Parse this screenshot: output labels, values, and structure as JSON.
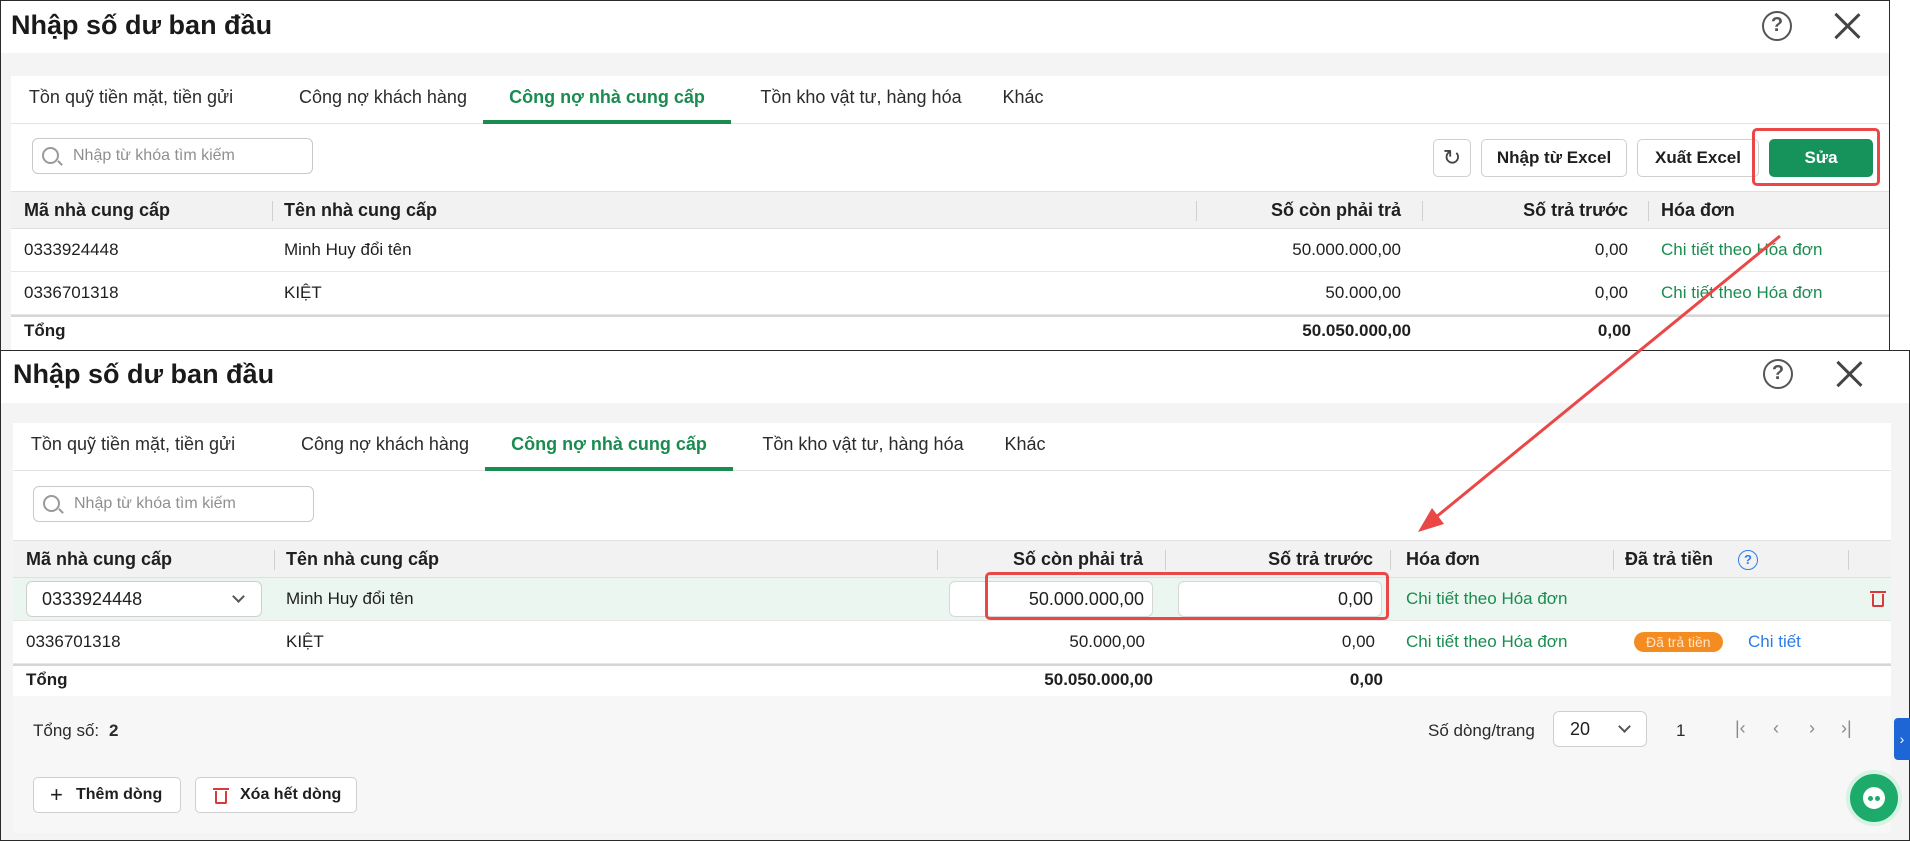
{
  "top_panel": {
    "title": "Nhập số dư ban đầu",
    "tabs": [
      "Tồn quỹ tiền mặt, tiền gửi",
      "Công nợ khách hàng",
      "Công nợ nhà cung cấp",
      "Tồn kho vật tư, hàng hóa",
      "Khác"
    ],
    "active_tab": "Công nợ nhà cung cấp",
    "search_placeholder": "Nhập từ khóa tìm kiếm",
    "buttons": {
      "import_excel": "Nhập từ Excel",
      "export_excel": "Xuất Excel",
      "edit": "Sửa"
    },
    "columns": [
      "Mã nhà cung cấp",
      "Tên nhà cung cấp",
      "Số còn phải trả",
      "Số trả trước",
      "Hóa đơn"
    ],
    "rows": [
      {
        "code": "0333924448",
        "name": "Minh Huy đổi tên",
        "payable": "50.000.000,00",
        "prepaid": "0,00",
        "invoice": "Chi tiết theo Hóa đơn"
      },
      {
        "code": "0336701318",
        "name": "KIỆT",
        "payable": "50.000,00",
        "prepaid": "0,00",
        "invoice": "Chi tiết theo Hóa đơn"
      }
    ],
    "total": {
      "label": "Tổng",
      "payable": "50.050.000,00",
      "prepaid": "0,00"
    }
  },
  "bottom_panel": {
    "title": "Nhập số dư ban đầu",
    "tabs": [
      "Tồn quỹ tiền mặt, tiền gửi",
      "Công nợ khách hàng",
      "Công nợ nhà cung cấp",
      "Tồn kho vật tư, hàng hóa",
      "Khác"
    ],
    "active_tab": "Công nợ nhà cung cấp",
    "search_placeholder": "Nhập từ khóa tìm kiếm",
    "columns": [
      "Mã nhà cung cấp",
      "Tên nhà cung cấp",
      "Số còn phải trả",
      "Số trả trước",
      "Hóa đơn",
      "Đã trả tiền"
    ],
    "rows": [
      {
        "code": "0333924448",
        "name": "Minh Huy đổi tên",
        "payable": "50.000.000,00",
        "prepaid": "0,00",
        "invoice": "Chi tiết theo Hóa đơn"
      },
      {
        "code": "0336701318",
        "name": "KIỆT",
        "payable": "50.000,00",
        "prepaid": "0,00",
        "invoice": "Chi tiết theo Hóa đơn",
        "paid_badge": "Đã trả tiền",
        "detail_link": "Chi tiết"
      }
    ],
    "total": {
      "label": "Tổng",
      "payable": "50.050.000,00",
      "prepaid": "0,00"
    },
    "record_count_label": "Tổng số:",
    "record_count": "2",
    "rows_per_page_label": "Số dòng/trang",
    "rows_per_page": "20",
    "current_page": "1",
    "buttons": {
      "add_row": "Thêm dòng",
      "delete_all": "Xóa hết dòng"
    }
  },
  "colors": {
    "accent": "#1a8c50",
    "highlight_box": "#ea4747",
    "badge": "#f58c22"
  }
}
